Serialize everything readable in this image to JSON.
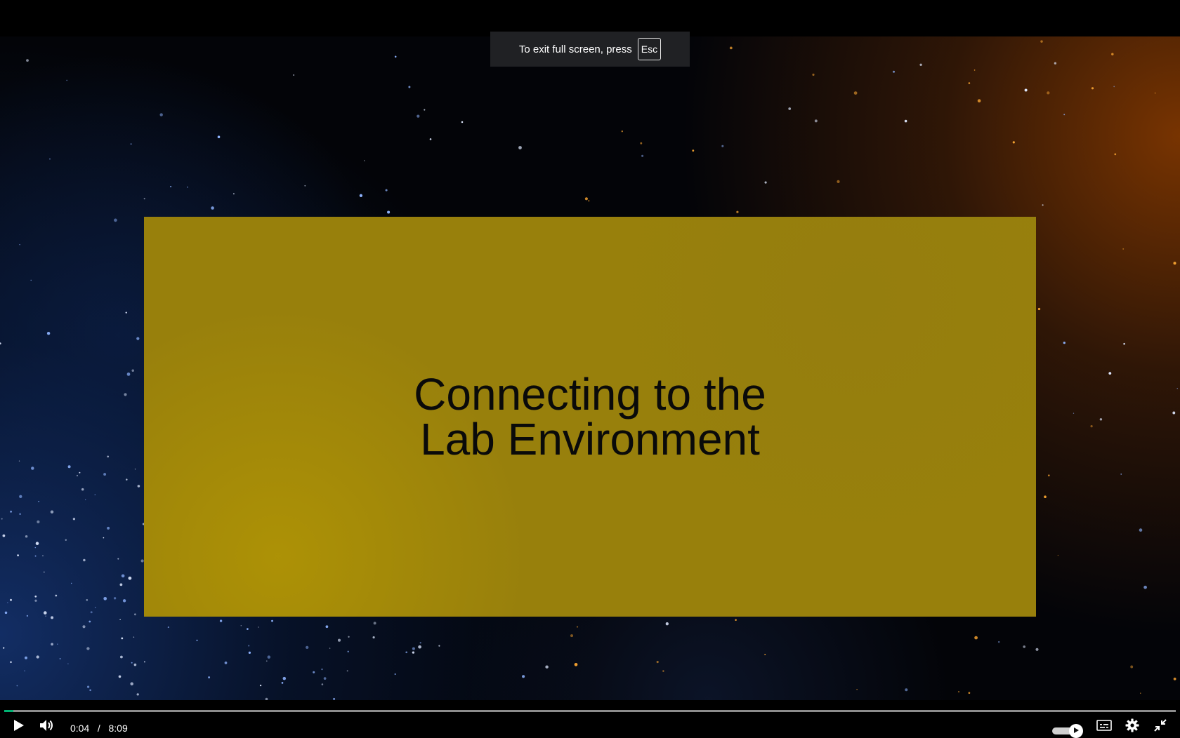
{
  "fullscreen_toast": {
    "message": "To exit full screen, press",
    "key": "Esc"
  },
  "slide": {
    "title_line1": "Connecting to the",
    "title_line2": "Lab Environment"
  },
  "player": {
    "current_time": "0:04",
    "separator": "/",
    "duration": "8:09",
    "progress_fraction": 0.008,
    "autoplay_on": true,
    "accent_color": "#00b373",
    "icons": {
      "play": "play-icon",
      "volume": "volume-icon",
      "autoplay": "autoplay-toggle",
      "captions": "captions-icon",
      "settings": "gear-icon",
      "exit_fullscreen": "exit-fullscreen-icon"
    }
  }
}
